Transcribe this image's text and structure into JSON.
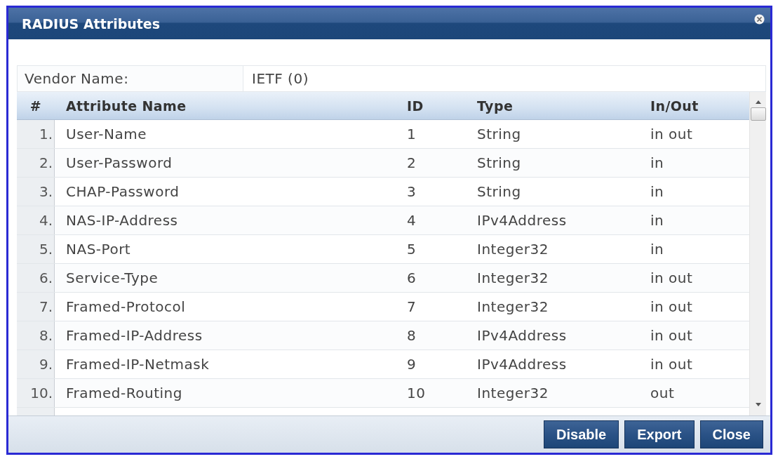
{
  "dialog": {
    "title": "RADIUS Attributes"
  },
  "vendor": {
    "label": "Vendor Name:",
    "value": "IETF (0)"
  },
  "table": {
    "columns": [
      "#",
      "Attribute Name",
      "ID",
      "Type",
      "In/Out"
    ],
    "rows": [
      {
        "index": "1.",
        "name": "User-Name",
        "id": "1",
        "type": "String",
        "in_out": "in out"
      },
      {
        "index": "2.",
        "name": "User-Password",
        "id": "2",
        "type": "String",
        "in_out": "in"
      },
      {
        "index": "3.",
        "name": "CHAP-Password",
        "id": "3",
        "type": "String",
        "in_out": "in"
      },
      {
        "index": "4.",
        "name": "NAS-IP-Address",
        "id": "4",
        "type": "IPv4Address",
        "in_out": "in"
      },
      {
        "index": "5.",
        "name": "NAS-Port",
        "id": "5",
        "type": "Integer32",
        "in_out": "in"
      },
      {
        "index": "6.",
        "name": "Service-Type",
        "id": "6",
        "type": "Integer32",
        "in_out": "in out"
      },
      {
        "index": "7.",
        "name": "Framed-Protocol",
        "id": "7",
        "type": "Integer32",
        "in_out": "in out"
      },
      {
        "index": "8.",
        "name": "Framed-IP-Address",
        "id": "8",
        "type": "IPv4Address",
        "in_out": "in out"
      },
      {
        "index": "9.",
        "name": "Framed-IP-Netmask",
        "id": "9",
        "type": "IPv4Address",
        "in_out": "in out"
      },
      {
        "index": "10.",
        "name": "Framed-Routing",
        "id": "10",
        "type": "Integer32",
        "in_out": "out"
      }
    ]
  },
  "buttons": [
    "Disable",
    "Export",
    "Close"
  ]
}
